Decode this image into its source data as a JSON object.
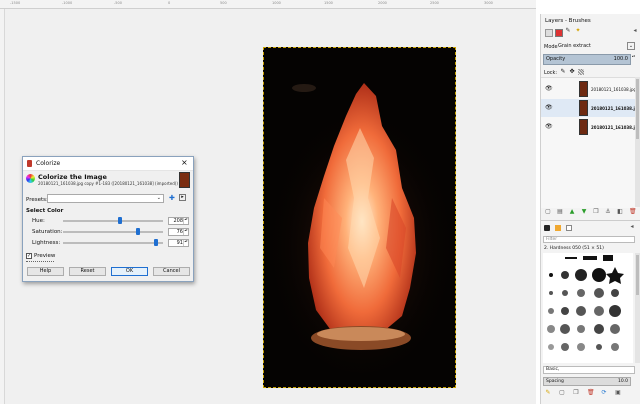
{
  "ruler": {
    "ticks": [
      "-1500",
      "-1000",
      "-500",
      "0",
      "500",
      "1000",
      "1500",
      "2000",
      "2500",
      "3000"
    ]
  },
  "dialog": {
    "title": "Colorize",
    "heading": "Colorize the Image",
    "subtitle": "20180121_161038.jpg copy #1-183 ([20180121_161038] (imported))",
    "presets_label": "Presets:",
    "section": "Select Color",
    "hue_label": "Hue:",
    "hue_value": "208",
    "saturation_label": "Saturation:",
    "saturation_value": "76",
    "lightness_label": "Lightness:",
    "lightness_value": "91",
    "preview_label": "Preview",
    "help": "Help",
    "reset": "Reset",
    "ok": "OK",
    "cancel": "Cancel",
    "hue_fraction": 0.578,
    "saturation_fraction": 0.76,
    "lightness_fraction": 0.95
  },
  "dock": {
    "title": "Layers - Brushes",
    "mode_label": "Mode",
    "mode_value": "Grain extract",
    "opacity_label": "Opacity",
    "opacity_value": "100.0",
    "lock_label": "Lock:",
    "layers": [
      {
        "name": "20180121_161038.jpg c",
        "selected": false
      },
      {
        "name": "20180121_161038.jp",
        "selected": true
      },
      {
        "name": "20180121_161038.jp",
        "selected": false
      }
    ],
    "filter_placeholder": "Filter",
    "brush_name": "2. Hardness 050 (51 × 51)",
    "tag_value": "Basic,",
    "spacing_label": "Spacing",
    "spacing_value": "10.0"
  },
  "colors": {
    "accent": "#1f6fd1",
    "photo_bg": "#050302",
    "selection": "#dfe9f5"
  }
}
